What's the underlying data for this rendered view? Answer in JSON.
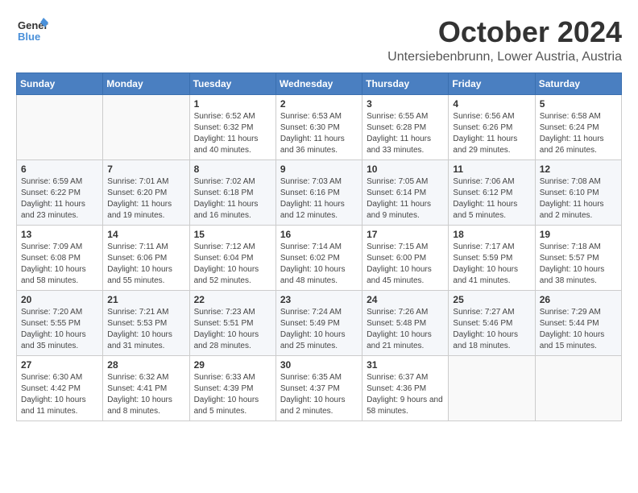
{
  "logo": {
    "general": "General",
    "blue": "Blue"
  },
  "title": {
    "month": "October 2024",
    "location": "Untersiebenbrunn, Lower Austria, Austria"
  },
  "headers": [
    "Sunday",
    "Monday",
    "Tuesday",
    "Wednesday",
    "Thursday",
    "Friday",
    "Saturday"
  ],
  "weeks": [
    [
      {
        "day": "",
        "info": ""
      },
      {
        "day": "",
        "info": ""
      },
      {
        "day": "1",
        "info": "Sunrise: 6:52 AM\nSunset: 6:32 PM\nDaylight: 11 hours and 40 minutes."
      },
      {
        "day": "2",
        "info": "Sunrise: 6:53 AM\nSunset: 6:30 PM\nDaylight: 11 hours and 36 minutes."
      },
      {
        "day": "3",
        "info": "Sunrise: 6:55 AM\nSunset: 6:28 PM\nDaylight: 11 hours and 33 minutes."
      },
      {
        "day": "4",
        "info": "Sunrise: 6:56 AM\nSunset: 6:26 PM\nDaylight: 11 hours and 29 minutes."
      },
      {
        "day": "5",
        "info": "Sunrise: 6:58 AM\nSunset: 6:24 PM\nDaylight: 11 hours and 26 minutes."
      }
    ],
    [
      {
        "day": "6",
        "info": "Sunrise: 6:59 AM\nSunset: 6:22 PM\nDaylight: 11 hours and 23 minutes."
      },
      {
        "day": "7",
        "info": "Sunrise: 7:01 AM\nSunset: 6:20 PM\nDaylight: 11 hours and 19 minutes."
      },
      {
        "day": "8",
        "info": "Sunrise: 7:02 AM\nSunset: 6:18 PM\nDaylight: 11 hours and 16 minutes."
      },
      {
        "day": "9",
        "info": "Sunrise: 7:03 AM\nSunset: 6:16 PM\nDaylight: 11 hours and 12 minutes."
      },
      {
        "day": "10",
        "info": "Sunrise: 7:05 AM\nSunset: 6:14 PM\nDaylight: 11 hours and 9 minutes."
      },
      {
        "day": "11",
        "info": "Sunrise: 7:06 AM\nSunset: 6:12 PM\nDaylight: 11 hours and 5 minutes."
      },
      {
        "day": "12",
        "info": "Sunrise: 7:08 AM\nSunset: 6:10 PM\nDaylight: 11 hours and 2 minutes."
      }
    ],
    [
      {
        "day": "13",
        "info": "Sunrise: 7:09 AM\nSunset: 6:08 PM\nDaylight: 10 hours and 58 minutes."
      },
      {
        "day": "14",
        "info": "Sunrise: 7:11 AM\nSunset: 6:06 PM\nDaylight: 10 hours and 55 minutes."
      },
      {
        "day": "15",
        "info": "Sunrise: 7:12 AM\nSunset: 6:04 PM\nDaylight: 10 hours and 52 minutes."
      },
      {
        "day": "16",
        "info": "Sunrise: 7:14 AM\nSunset: 6:02 PM\nDaylight: 10 hours and 48 minutes."
      },
      {
        "day": "17",
        "info": "Sunrise: 7:15 AM\nSunset: 6:00 PM\nDaylight: 10 hours and 45 minutes."
      },
      {
        "day": "18",
        "info": "Sunrise: 7:17 AM\nSunset: 5:59 PM\nDaylight: 10 hours and 41 minutes."
      },
      {
        "day": "19",
        "info": "Sunrise: 7:18 AM\nSunset: 5:57 PM\nDaylight: 10 hours and 38 minutes."
      }
    ],
    [
      {
        "day": "20",
        "info": "Sunrise: 7:20 AM\nSunset: 5:55 PM\nDaylight: 10 hours and 35 minutes."
      },
      {
        "day": "21",
        "info": "Sunrise: 7:21 AM\nSunset: 5:53 PM\nDaylight: 10 hours and 31 minutes."
      },
      {
        "day": "22",
        "info": "Sunrise: 7:23 AM\nSunset: 5:51 PM\nDaylight: 10 hours and 28 minutes."
      },
      {
        "day": "23",
        "info": "Sunrise: 7:24 AM\nSunset: 5:49 PM\nDaylight: 10 hours and 25 minutes."
      },
      {
        "day": "24",
        "info": "Sunrise: 7:26 AM\nSunset: 5:48 PM\nDaylight: 10 hours and 21 minutes."
      },
      {
        "day": "25",
        "info": "Sunrise: 7:27 AM\nSunset: 5:46 PM\nDaylight: 10 hours and 18 minutes."
      },
      {
        "day": "26",
        "info": "Sunrise: 7:29 AM\nSunset: 5:44 PM\nDaylight: 10 hours and 15 minutes."
      }
    ],
    [
      {
        "day": "27",
        "info": "Sunrise: 6:30 AM\nSunset: 4:42 PM\nDaylight: 10 hours and 11 minutes."
      },
      {
        "day": "28",
        "info": "Sunrise: 6:32 AM\nSunset: 4:41 PM\nDaylight: 10 hours and 8 minutes."
      },
      {
        "day": "29",
        "info": "Sunrise: 6:33 AM\nSunset: 4:39 PM\nDaylight: 10 hours and 5 minutes."
      },
      {
        "day": "30",
        "info": "Sunrise: 6:35 AM\nSunset: 4:37 PM\nDaylight: 10 hours and 2 minutes."
      },
      {
        "day": "31",
        "info": "Sunrise: 6:37 AM\nSunset: 4:36 PM\nDaylight: 9 hours and 58 minutes."
      },
      {
        "day": "",
        "info": ""
      },
      {
        "day": "",
        "info": ""
      }
    ]
  ]
}
